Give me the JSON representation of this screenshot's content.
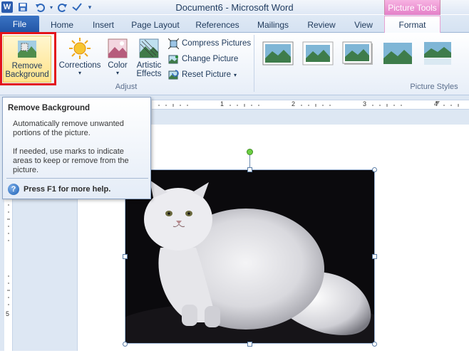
{
  "window": {
    "title": "Document6 - Microsoft Word",
    "contextual_header": "Picture Tools"
  },
  "quick_access": {
    "icons": [
      "word-icon",
      "save-icon",
      "undo-icon",
      "redo-icon",
      "customize-icon"
    ]
  },
  "tabs": [
    {
      "label": "File"
    },
    {
      "label": "Home"
    },
    {
      "label": "Insert"
    },
    {
      "label": "Page Layout"
    },
    {
      "label": "References"
    },
    {
      "label": "Mailings"
    },
    {
      "label": "Review"
    },
    {
      "label": "View"
    },
    {
      "label": "Format"
    }
  ],
  "ribbon": {
    "remove_background": "Remove\nBackground",
    "remove_background_l1": "Remove",
    "remove_background_l2": "Background",
    "corrections": "Corrections",
    "color": "Color",
    "artistic_effects_l1": "Artistic",
    "artistic_effects_l2": "Effects",
    "compress_pictures": "Compress Pictures",
    "change_picture": "Change Picture",
    "reset_picture": "Reset Picture",
    "adjust_group": "Adjust",
    "picture_styles_group": "Picture Styles"
  },
  "tooltip": {
    "title": "Remove Background",
    "p1": "Automatically remove unwanted portions of the picture.",
    "p2": "If needed, use marks to indicate areas to keep or remove from the picture.",
    "help": "Press F1 for more help."
  },
  "ruler": {
    "labels": [
      "1",
      "2",
      "3",
      "4",
      "5"
    ]
  },
  "colors": {
    "accent": "#2155a5",
    "contextual": "#e47fc8",
    "highlight": "#e3141c"
  }
}
